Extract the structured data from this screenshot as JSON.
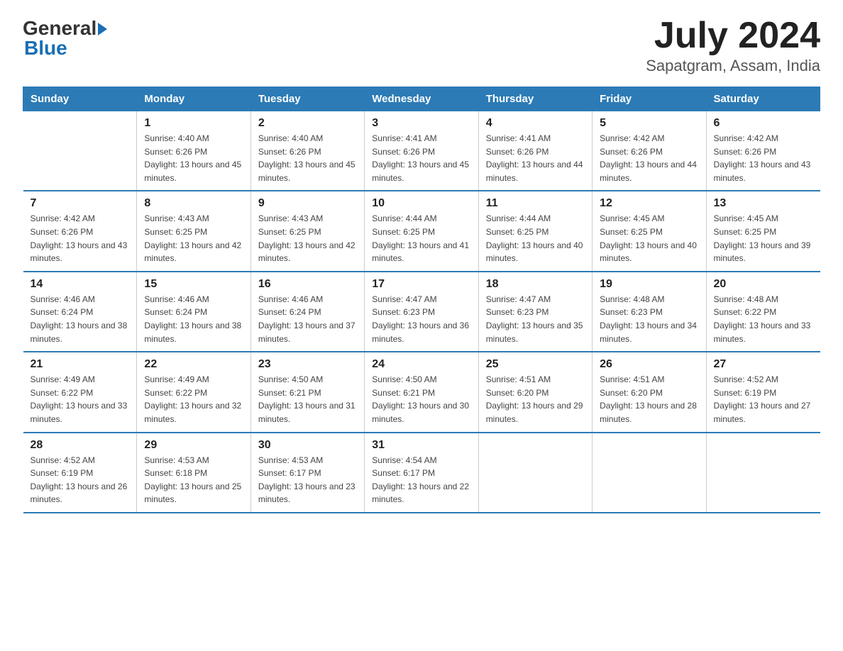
{
  "header": {
    "logo_general": "General",
    "logo_blue": "Blue",
    "month": "July 2024",
    "location": "Sapatgram, Assam, India"
  },
  "columns": [
    "Sunday",
    "Monday",
    "Tuesday",
    "Wednesday",
    "Thursday",
    "Friday",
    "Saturday"
  ],
  "weeks": [
    [
      {
        "day": "",
        "sunrise": "",
        "sunset": "",
        "daylight": ""
      },
      {
        "day": "1",
        "sunrise": "Sunrise: 4:40 AM",
        "sunset": "Sunset: 6:26 PM",
        "daylight": "Daylight: 13 hours and 45 minutes."
      },
      {
        "day": "2",
        "sunrise": "Sunrise: 4:40 AM",
        "sunset": "Sunset: 6:26 PM",
        "daylight": "Daylight: 13 hours and 45 minutes."
      },
      {
        "day": "3",
        "sunrise": "Sunrise: 4:41 AM",
        "sunset": "Sunset: 6:26 PM",
        "daylight": "Daylight: 13 hours and 45 minutes."
      },
      {
        "day": "4",
        "sunrise": "Sunrise: 4:41 AM",
        "sunset": "Sunset: 6:26 PM",
        "daylight": "Daylight: 13 hours and 44 minutes."
      },
      {
        "day": "5",
        "sunrise": "Sunrise: 4:42 AM",
        "sunset": "Sunset: 6:26 PM",
        "daylight": "Daylight: 13 hours and 44 minutes."
      },
      {
        "day": "6",
        "sunrise": "Sunrise: 4:42 AM",
        "sunset": "Sunset: 6:26 PM",
        "daylight": "Daylight: 13 hours and 43 minutes."
      }
    ],
    [
      {
        "day": "7",
        "sunrise": "Sunrise: 4:42 AM",
        "sunset": "Sunset: 6:26 PM",
        "daylight": "Daylight: 13 hours and 43 minutes."
      },
      {
        "day": "8",
        "sunrise": "Sunrise: 4:43 AM",
        "sunset": "Sunset: 6:25 PM",
        "daylight": "Daylight: 13 hours and 42 minutes."
      },
      {
        "day": "9",
        "sunrise": "Sunrise: 4:43 AM",
        "sunset": "Sunset: 6:25 PM",
        "daylight": "Daylight: 13 hours and 42 minutes."
      },
      {
        "day": "10",
        "sunrise": "Sunrise: 4:44 AM",
        "sunset": "Sunset: 6:25 PM",
        "daylight": "Daylight: 13 hours and 41 minutes."
      },
      {
        "day": "11",
        "sunrise": "Sunrise: 4:44 AM",
        "sunset": "Sunset: 6:25 PM",
        "daylight": "Daylight: 13 hours and 40 minutes."
      },
      {
        "day": "12",
        "sunrise": "Sunrise: 4:45 AM",
        "sunset": "Sunset: 6:25 PM",
        "daylight": "Daylight: 13 hours and 40 minutes."
      },
      {
        "day": "13",
        "sunrise": "Sunrise: 4:45 AM",
        "sunset": "Sunset: 6:25 PM",
        "daylight": "Daylight: 13 hours and 39 minutes."
      }
    ],
    [
      {
        "day": "14",
        "sunrise": "Sunrise: 4:46 AM",
        "sunset": "Sunset: 6:24 PM",
        "daylight": "Daylight: 13 hours and 38 minutes."
      },
      {
        "day": "15",
        "sunrise": "Sunrise: 4:46 AM",
        "sunset": "Sunset: 6:24 PM",
        "daylight": "Daylight: 13 hours and 38 minutes."
      },
      {
        "day": "16",
        "sunrise": "Sunrise: 4:46 AM",
        "sunset": "Sunset: 6:24 PM",
        "daylight": "Daylight: 13 hours and 37 minutes."
      },
      {
        "day": "17",
        "sunrise": "Sunrise: 4:47 AM",
        "sunset": "Sunset: 6:23 PM",
        "daylight": "Daylight: 13 hours and 36 minutes."
      },
      {
        "day": "18",
        "sunrise": "Sunrise: 4:47 AM",
        "sunset": "Sunset: 6:23 PM",
        "daylight": "Daylight: 13 hours and 35 minutes."
      },
      {
        "day": "19",
        "sunrise": "Sunrise: 4:48 AM",
        "sunset": "Sunset: 6:23 PM",
        "daylight": "Daylight: 13 hours and 34 minutes."
      },
      {
        "day": "20",
        "sunrise": "Sunrise: 4:48 AM",
        "sunset": "Sunset: 6:22 PM",
        "daylight": "Daylight: 13 hours and 33 minutes."
      }
    ],
    [
      {
        "day": "21",
        "sunrise": "Sunrise: 4:49 AM",
        "sunset": "Sunset: 6:22 PM",
        "daylight": "Daylight: 13 hours and 33 minutes."
      },
      {
        "day": "22",
        "sunrise": "Sunrise: 4:49 AM",
        "sunset": "Sunset: 6:22 PM",
        "daylight": "Daylight: 13 hours and 32 minutes."
      },
      {
        "day": "23",
        "sunrise": "Sunrise: 4:50 AM",
        "sunset": "Sunset: 6:21 PM",
        "daylight": "Daylight: 13 hours and 31 minutes."
      },
      {
        "day": "24",
        "sunrise": "Sunrise: 4:50 AM",
        "sunset": "Sunset: 6:21 PM",
        "daylight": "Daylight: 13 hours and 30 minutes."
      },
      {
        "day": "25",
        "sunrise": "Sunrise: 4:51 AM",
        "sunset": "Sunset: 6:20 PM",
        "daylight": "Daylight: 13 hours and 29 minutes."
      },
      {
        "day": "26",
        "sunrise": "Sunrise: 4:51 AM",
        "sunset": "Sunset: 6:20 PM",
        "daylight": "Daylight: 13 hours and 28 minutes."
      },
      {
        "day": "27",
        "sunrise": "Sunrise: 4:52 AM",
        "sunset": "Sunset: 6:19 PM",
        "daylight": "Daylight: 13 hours and 27 minutes."
      }
    ],
    [
      {
        "day": "28",
        "sunrise": "Sunrise: 4:52 AM",
        "sunset": "Sunset: 6:19 PM",
        "daylight": "Daylight: 13 hours and 26 minutes."
      },
      {
        "day": "29",
        "sunrise": "Sunrise: 4:53 AM",
        "sunset": "Sunset: 6:18 PM",
        "daylight": "Daylight: 13 hours and 25 minutes."
      },
      {
        "day": "30",
        "sunrise": "Sunrise: 4:53 AM",
        "sunset": "Sunset: 6:17 PM",
        "daylight": "Daylight: 13 hours and 23 minutes."
      },
      {
        "day": "31",
        "sunrise": "Sunrise: 4:54 AM",
        "sunset": "Sunset: 6:17 PM",
        "daylight": "Daylight: 13 hours and 22 minutes."
      },
      {
        "day": "",
        "sunrise": "",
        "sunset": "",
        "daylight": ""
      },
      {
        "day": "",
        "sunrise": "",
        "sunset": "",
        "daylight": ""
      },
      {
        "day": "",
        "sunrise": "",
        "sunset": "",
        "daylight": ""
      }
    ]
  ]
}
